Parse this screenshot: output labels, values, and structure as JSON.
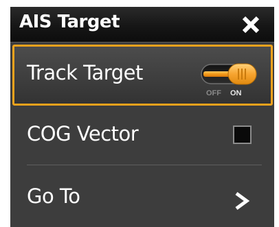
{
  "dialog": {
    "title": "AIS Target",
    "close_icon": "close-icon"
  },
  "items": [
    {
      "label": "Track Target",
      "control": "toggle",
      "state": "on",
      "off_label": "OFF",
      "on_label": "ON",
      "selected": true
    },
    {
      "label": "COG Vector",
      "control": "checkbox",
      "checked": false
    },
    {
      "label": "Go To",
      "control": "chevron-right-icon"
    }
  ],
  "colors": {
    "accent": "#f0a21c",
    "panel": "#3d3d3d",
    "header": "#161616",
    "text": "#ffffff"
  }
}
